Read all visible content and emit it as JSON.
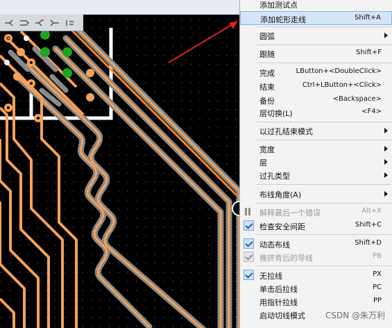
{
  "toolbar": {
    "icons": [
      "route-icon",
      "route-arrow-icon",
      "route-split-icon",
      "route-merge-icon",
      "route-extra-icon"
    ]
  },
  "context_menu": {
    "items": [
      {
        "label": "添加测试点",
        "shortcut": "",
        "submenu": false,
        "checked": false,
        "disabled": false,
        "highlight": false
      },
      {
        "label": "添加蛇形走线",
        "shortcut": "Shift+A",
        "submenu": false,
        "checked": false,
        "disabled": false,
        "highlight": true
      },
      {
        "label": "圆弧",
        "shortcut": "",
        "submenu": true,
        "checked": false,
        "disabled": false,
        "highlight": false
      },
      {
        "label": "跟随",
        "shortcut": "Shift+F",
        "submenu": false,
        "checked": false,
        "disabled": false,
        "highlight": false
      },
      {
        "label": "完成",
        "shortcut": "LButton+<DoubleClick>",
        "submenu": false,
        "checked": false,
        "disabled": false,
        "highlight": false
      },
      {
        "label": "结束",
        "shortcut": "Ctrl+LButton+<Click>",
        "submenu": false,
        "checked": false,
        "disabled": false,
        "highlight": false
      },
      {
        "label": "备份",
        "shortcut": "<Backspace>",
        "submenu": false,
        "checked": false,
        "disabled": false,
        "highlight": false
      },
      {
        "label": "层切换(L)",
        "shortcut": "<F4>",
        "submenu": false,
        "checked": false,
        "disabled": false,
        "highlight": false
      },
      {
        "label": "以过孔结束模式",
        "shortcut": "",
        "submenu": true,
        "checked": false,
        "disabled": false,
        "highlight": false
      },
      {
        "label": "宽度",
        "shortcut": "",
        "submenu": true,
        "checked": false,
        "disabled": false,
        "highlight": false
      },
      {
        "label": "层",
        "shortcut": "",
        "submenu": true,
        "checked": false,
        "disabled": false,
        "highlight": false
      },
      {
        "label": "过孔类型",
        "shortcut": "",
        "submenu": true,
        "checked": false,
        "disabled": false,
        "highlight": false
      },
      {
        "label": "布线角度(A)",
        "shortcut": "",
        "submenu": true,
        "checked": false,
        "disabled": false,
        "highlight": false
      },
      {
        "label": "解释最后一个错误",
        "shortcut": "Alt+X",
        "submenu": false,
        "checked": false,
        "disabled": true,
        "highlight": false
      },
      {
        "label": "检查安全间距",
        "shortcut": "Shift+C",
        "submenu": false,
        "checked": true,
        "disabled": false,
        "highlight": false
      },
      {
        "label": "动态布线",
        "shortcut": "Shift+D",
        "submenu": false,
        "checked": true,
        "disabled": false,
        "highlight": false
      },
      {
        "label": "推挤背后的导线",
        "shortcut": "PB",
        "submenu": false,
        "checked": true,
        "disabled": true,
        "highlight": false
      },
      {
        "label": "无拉线",
        "shortcut": "PX",
        "submenu": false,
        "checked": true,
        "disabled": false,
        "highlight": false
      },
      {
        "label": "单击后拉线",
        "shortcut": "PC",
        "submenu": false,
        "checked": false,
        "disabled": false,
        "highlight": false
      },
      {
        "label": "用指针拉线",
        "shortcut": "PP",
        "submenu": false,
        "checked": false,
        "disabled": false,
        "highlight": false
      },
      {
        "label": "启动切线模式",
        "shortcut": "PT",
        "submenu": false,
        "checked": false,
        "disabled": false,
        "highlight": false
      }
    ]
  },
  "watermark": "CSDN @朱万利",
  "colors": {
    "trace": "#f4a25a",
    "pad_green": "#1fa41f",
    "board": "#000000",
    "board_edge": "#ffffff",
    "menu_highlight": "#d5e5f7",
    "arrow": "#e02020"
  }
}
